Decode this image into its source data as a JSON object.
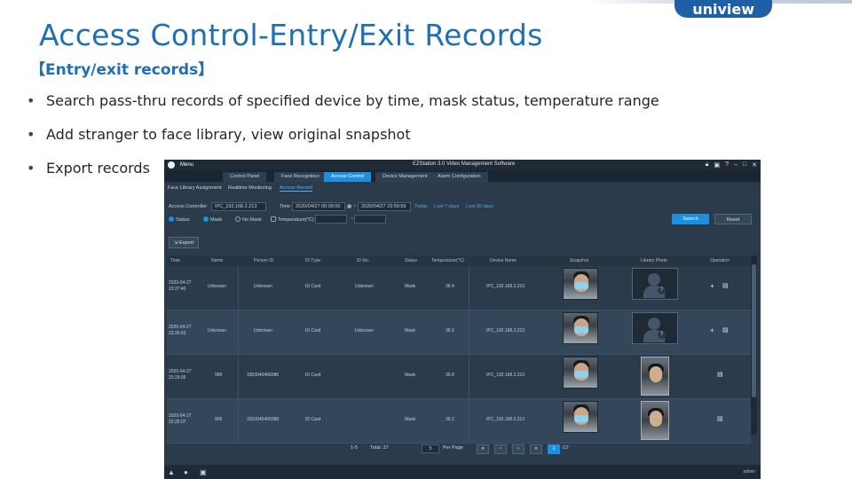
{
  "slide": {
    "title": "Access Control-Entry/Exit Records",
    "subtitle": "【Entry/exit records】",
    "brand": "uniview",
    "bullets": [
      "Search pass-thru records of specified device by time, mask status, temperature range",
      "Add stranger to face library, view original snapshot",
      "Export records"
    ]
  },
  "app": {
    "menu_label": "Menu",
    "title": "EZStation 3.0 Video Management Software",
    "window_controls": [
      "lock-icon",
      "save-icon",
      "help-icon",
      "minimize-icon",
      "maximize-icon",
      "close-icon"
    ],
    "tabs": [
      {
        "label": "Control Panel",
        "active": false
      },
      {
        "label": "Face Recognition",
        "active": false
      },
      {
        "label": "Access Control",
        "active": true
      },
      {
        "label": "Device Management",
        "active": false
      },
      {
        "label": "Alarm Configuration",
        "active": false
      }
    ],
    "subtabs": [
      {
        "label": "Face Library Assignment",
        "active": false
      },
      {
        "label": "Realtime Monitoring",
        "active": false
      },
      {
        "label": "Access Record",
        "active": true
      }
    ],
    "filters": {
      "access_controller_label": "Access Controller",
      "access_controller_value": "IPC_192.168.2.213",
      "time_label": "Time",
      "time_start": "2020/04/27 00:00:00",
      "time_end": "2020/04/27 23:59:59",
      "quick_links": [
        "Today",
        "Last 7 days",
        "Last 30 days"
      ],
      "mask_options": [
        {
          "label": "Status",
          "selected": true
        },
        {
          "label": "Mask",
          "selected": true
        },
        {
          "label": "No Mask",
          "selected": false
        }
      ],
      "temperature_label": "Temperature(°C)",
      "temperature_separator": "~"
    },
    "buttons": {
      "search": "Search",
      "reset": "Reset",
      "export": "Export"
    },
    "table": {
      "columns": [
        "Time",
        "Name",
        "Person ID",
        "ID Type",
        "ID No.",
        "Status",
        "Temperature(°C)",
        "Device Name",
        "Snapshot",
        "Library Photo",
        "Operation"
      ],
      "rows": [
        {
          "time": [
            "2020-04-27",
            "23:27:40"
          ],
          "name": "Unknown",
          "person_id": "Unknown",
          "id_type": "ID Card",
          "id_no": "Unknown",
          "status": "Mask",
          "temperature": "36.4",
          "device": "IPC_192.168.2.213",
          "library": "unknown",
          "ops": [
            "add-to-library-icon",
            "view-snapshot-icon"
          ]
        },
        {
          "time": [
            "2020-04-27",
            "23:26:43"
          ],
          "name": "Unknown",
          "person_id": "Unknown",
          "id_type": "ID Card",
          "id_no": "Unknown",
          "status": "Mask",
          "temperature": "36.2",
          "device": "IPC_192.168.2.213",
          "library": "unknown",
          "ops": [
            "add-to-library-icon",
            "view-snapshot-icon"
          ]
        },
        {
          "time": [
            "2020-04-27",
            "23:26:05"
          ],
          "name": "999",
          "person_id": "3303045466086",
          "id_type": "ID Card",
          "id_no": "",
          "status": "Mask",
          "temperature": "35.8",
          "device": "IPC_192.168.2.213",
          "library": "photo",
          "ops": [
            "view-snapshot-icon"
          ]
        },
        {
          "time": [
            "2020-04-27",
            "23:25:07"
          ],
          "name": "999",
          "person_id": "3303045466086",
          "id_type": "ID Card",
          "id_no": "",
          "status": "Mask",
          "temperature": "36.2",
          "device": "IPC_192.168.2.213",
          "library": "photo",
          "ops": [
            "view-snapshot-icon"
          ]
        }
      ]
    },
    "pager": {
      "range_text": "1-5",
      "total_text": "Total: 37",
      "per_page_value": "5",
      "per_page_label": "Per Page",
      "current_page": "1",
      "page_total": "/12"
    },
    "status_icons": [
      "alarm-icon",
      "user-icon",
      "screen-icon"
    ],
    "status_right": "admin"
  }
}
